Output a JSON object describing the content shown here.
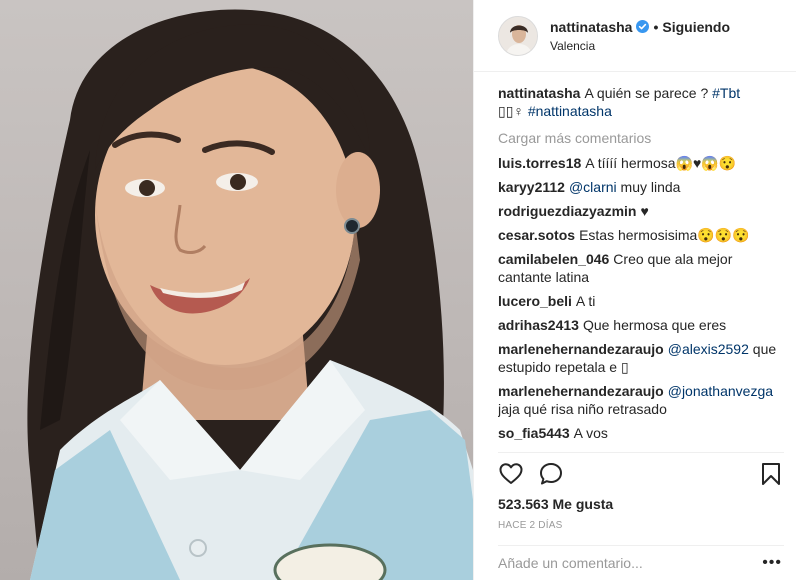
{
  "post": {
    "username": "nattinatasha",
    "verified": true,
    "follow_status": "Siguiendo",
    "separator": "•",
    "location": "Valencia",
    "caption": {
      "user": "nattinatasha",
      "text": "A quién se parece ? ",
      "hashtag1": "#Tbt",
      "emojis": "▯▯♀",
      "hashtag2": "#nattinatasha"
    },
    "load_more": "Cargar más comentarios",
    "comments": [
      {
        "user": "luis.torres18",
        "text": "A tíííí hermosa😱♥😱😯"
      },
      {
        "user": "karyy2112",
        "mention": "@clarni",
        "text": " muy linda"
      },
      {
        "user": "rodriguezdiazyazmin",
        "text": "♥"
      },
      {
        "user": "cesar.sotos",
        "text": "Estas hermosisima😯😯😯"
      },
      {
        "user": "camilabelen_046",
        "text": "Creo que ala mejor cantante latina"
      },
      {
        "user": "lucero_beli",
        "text": "A ti"
      },
      {
        "user": "adrihas2413",
        "text": "Que hermosa que eres"
      },
      {
        "user": "marlenehernandezaraujo",
        "mention": "@alexis2592",
        "text": " que estupido repetala e ▯"
      },
      {
        "user": "marlenehernandezaraujo",
        "mention": "@jonathanvezga",
        "text": " jaja qué risa niño retrasado"
      },
      {
        "user": "so_fia5443",
        "text": "A vos"
      }
    ],
    "likes": "523.563 Me gusta",
    "time_ago": "HACE 2 DÍAS",
    "comment_placeholder": "Añade un comentario...",
    "more_options": "•••"
  },
  "icons": {
    "like": "heart-icon",
    "comment": "speech-bubble-icon",
    "save": "bookmark-icon",
    "verified": "verified-badge-icon"
  },
  "colors": {
    "verified_blue": "#3897f0",
    "link_blue": "#003569",
    "muted": "#999999",
    "text": "#262626"
  }
}
